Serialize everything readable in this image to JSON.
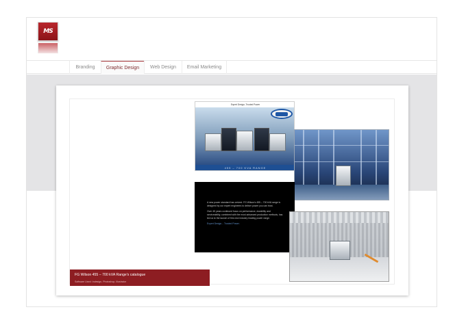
{
  "logo": {
    "mark": "MS",
    "alt": "MS logo"
  },
  "nav": {
    "tabs": [
      {
        "label": "Branding",
        "active": false
      },
      {
        "label": "Graphic Design",
        "active": true
      },
      {
        "label": "Web Design",
        "active": false
      },
      {
        "label": "Email Marketing",
        "active": false
      }
    ]
  },
  "portfolio": {
    "brochure_cover": {
      "tagline": "Expert Design, Trusted Power",
      "range_label": "455 – 700 KVA RANGE"
    },
    "brochure_text": {
      "paragraph_1": "A new power standard has arrived. FG Wilson's 455 – 700 kVA range is designed by our expert engineers to deliver power you can trust.",
      "paragraph_2": "Over 45 years continued focus on performance, durability and serviceability, combined with the most advanced production methods, has led us to the launch of this new industry leading power range.",
      "link": "Expert Design... Trusted Power."
    },
    "caption": {
      "title": "FG Wilson 455 – 700 kVA Range's catalogue",
      "software": "Software Used: Indesign, Photoshop, Illustrator"
    }
  },
  "colors": {
    "brand_red": "#8d1d22",
    "nav_active": "#7e2a2d",
    "band_gray": "#e4e4e6",
    "cover_blue": "#1e4f93"
  }
}
